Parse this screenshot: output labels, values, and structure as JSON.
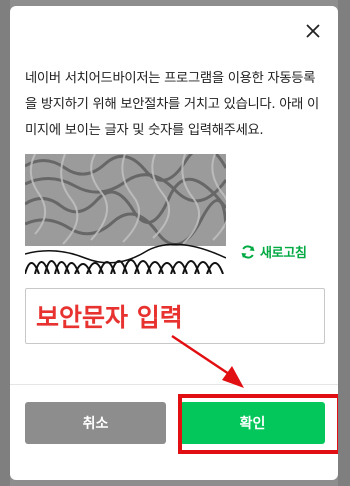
{
  "dialog": {
    "description": "네이버 서치어드바이저는 프로그램을 이용한 자동등록을 방지하기 위해 보안절차를 거치고 있습니다. 아래 이미지에 보이는 글자 및 숫자를 입력해주세요.",
    "refresh_label": "새로고침",
    "input_value": "보안문자 입력",
    "cancel_label": "취소",
    "confirm_label": "확인"
  },
  "icons": {
    "close": "close-icon",
    "refresh": "refresh-icon"
  },
  "colors": {
    "accent_green": "#03c75a",
    "refresh_green": "#03a943",
    "cancel_gray": "#8d8d8d",
    "annotation_red": "#e20f12"
  }
}
